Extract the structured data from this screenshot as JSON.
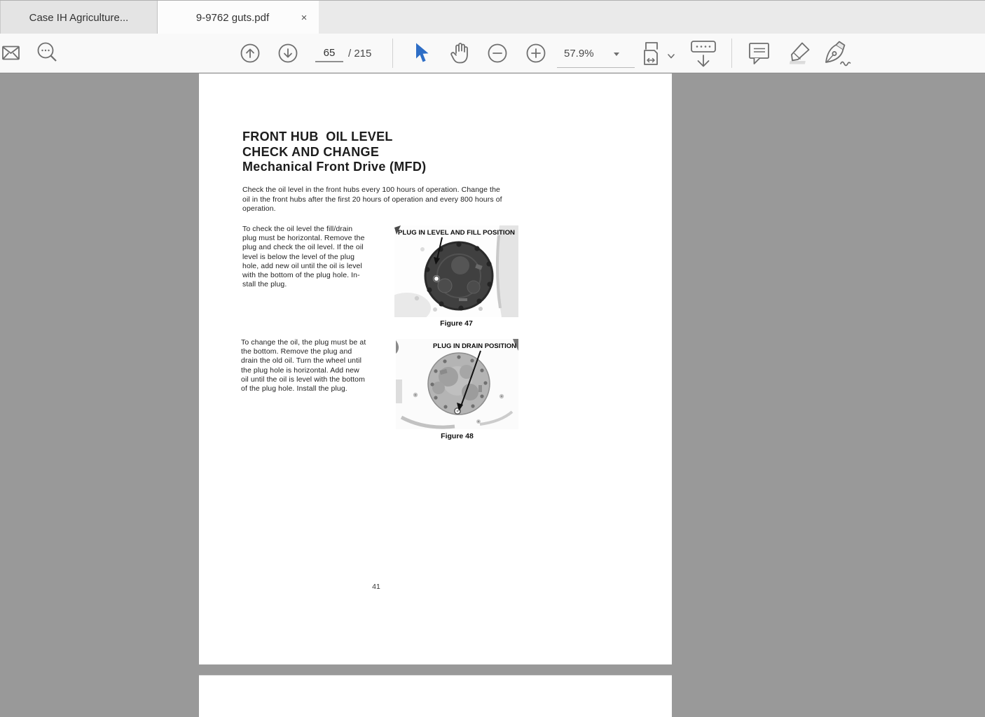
{
  "window": {
    "tabs": [
      {
        "label": "Case IH Agriculture...",
        "active": false
      },
      {
        "label": "9-9762 guts.pdf",
        "active": true
      }
    ],
    "close_label": "×"
  },
  "toolbar": {
    "page_input": "65",
    "page_total": "/ 215",
    "zoom_level": "57.9%",
    "icons": [
      "email-icon",
      "search-icon",
      "page-up-icon",
      "page-down-icon",
      "select-tool-icon",
      "pan-tool-icon",
      "zoom-out-icon",
      "zoom-in-icon",
      "fit-width-icon",
      "dock-toolbar-icon",
      "add-notes-icon",
      "highlighter-icon",
      "ink-pen-icon"
    ]
  },
  "document": {
    "title_lines": [
      "FRONT HUB  OIL LEVEL",
      "CHECK AND CHANGE",
      "Mechanical Front Drive (MFD)"
    ],
    "intro": "Check the oil level in the front hubs every 100 hours of operation. Change the\noil in the front hubs after the first 20 hours of operation and every 800 hours of\noperation.",
    "check_paragraph": "To check the oil level the fill/drain\nplug must be horizontal. Remove the\nplug and check the oil level. If the oil\nlevel is below the level of the plug\nhole, add new oil until the oil is level\nwith the bottom of the plug hole. In-\nstall the plug.",
    "change_paragraph": "To change the oil, the plug must be at\nthe bottom. Remove the plug and\ndrain the old oil. Turn the wheel until\nthe plug hole is horizontal. Add new\noil until the oil is level with the bottom\nof the plug hole. Install the plug.",
    "figure47": {
      "label": "PLUG IN LEVEL AND FILL POSITION",
      "caption": "Figure 47"
    },
    "figure48": {
      "label": "PLUG IN DRAIN POSITION",
      "caption": "Figure 48"
    },
    "page_number": "41"
  },
  "colors": {
    "accent_blue": "#2e6ec6",
    "canvas_gray": "#999999",
    "toolbar_bg": "#f9f9f9",
    "tabstrip_bg": "#eaeaea",
    "icon_gray": "#6f6f6f"
  }
}
